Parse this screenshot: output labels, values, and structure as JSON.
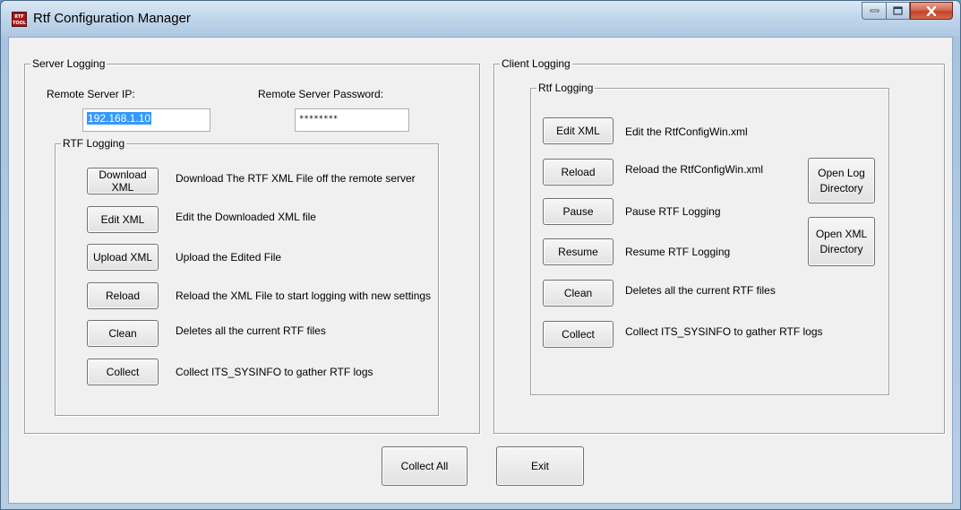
{
  "window": {
    "title": "Rtf Configuration Manager",
    "icon": "rtf-tool-icon",
    "icon_text": "RTF TOOL"
  },
  "server": {
    "group_label": "Server Logging",
    "ip_label": "Remote Server IP:",
    "ip_value": "192.168.1.10",
    "password_label": "Remote Server Password:",
    "password_value": "********",
    "rtf": {
      "group_label": "RTF Logging",
      "rows": [
        {
          "button": "Download XML",
          "desc": "Download The RTF XML File off the remote server"
        },
        {
          "button": "Edit XML",
          "desc": "Edit the Downloaded XML file"
        },
        {
          "button": "Upload XML",
          "desc": "Upload the Edited File"
        },
        {
          "button": "Reload",
          "desc": "Reload the XML File to start logging with new settings"
        },
        {
          "button": "Clean",
          "desc": "Deletes all the current RTF files"
        },
        {
          "button": "Collect",
          "desc": "Collect ITS_SYSINFO to gather RTF logs"
        }
      ]
    }
  },
  "client": {
    "group_label": "Client Logging",
    "rtf": {
      "group_label": "Rtf Logging",
      "rows": [
        {
          "button": "Edit XML",
          "desc": "Edit the RtfConfigWin.xml"
        },
        {
          "button": "Reload",
          "desc": "Reload the RtfConfigWin.xml"
        },
        {
          "button": "Pause",
          "desc": "Pause RTF Logging"
        },
        {
          "button": "Resume",
          "desc": "Resume RTF Logging"
        },
        {
          "button": "Clean",
          "desc": "Deletes all the current RTF files"
        },
        {
          "button": "Collect",
          "desc": "Collect ITS_SYSINFO to gather RTF logs"
        }
      ],
      "open_log_line1": "Open Log",
      "open_log_line2": "Directory",
      "open_xml_line1": "Open XML",
      "open_xml_line2": "Directory"
    }
  },
  "footer": {
    "collect_all": "Collect All",
    "exit": "Exit"
  },
  "colors": {
    "accent_selection": "#3399ff",
    "close_button": "#c7442d",
    "icon_red": "#a0161a"
  }
}
